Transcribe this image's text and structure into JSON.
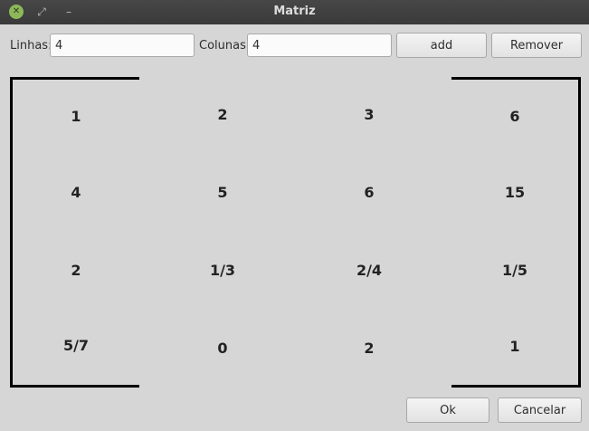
{
  "window": {
    "title": "Matriz"
  },
  "toolbar": {
    "rows_label": "Linhas:",
    "rows_value": "4",
    "cols_label": "Colunas:",
    "cols_value": "4",
    "add_label": "add",
    "remove_label": "Remover"
  },
  "matrix": [
    [
      "1",
      "2",
      "3",
      "6"
    ],
    [
      "4",
      "5",
      "6",
      "15"
    ],
    [
      "2",
      "1/3",
      "2/4",
      "1/5"
    ],
    [
      "5/7",
      "0",
      "2",
      "1"
    ]
  ],
  "footer": {
    "ok_label": "Ok",
    "cancel_label": "Cancelar"
  },
  "icons": {
    "close": "close-icon",
    "maximize": "maximize-icon",
    "minimize": "minimize-icon"
  }
}
